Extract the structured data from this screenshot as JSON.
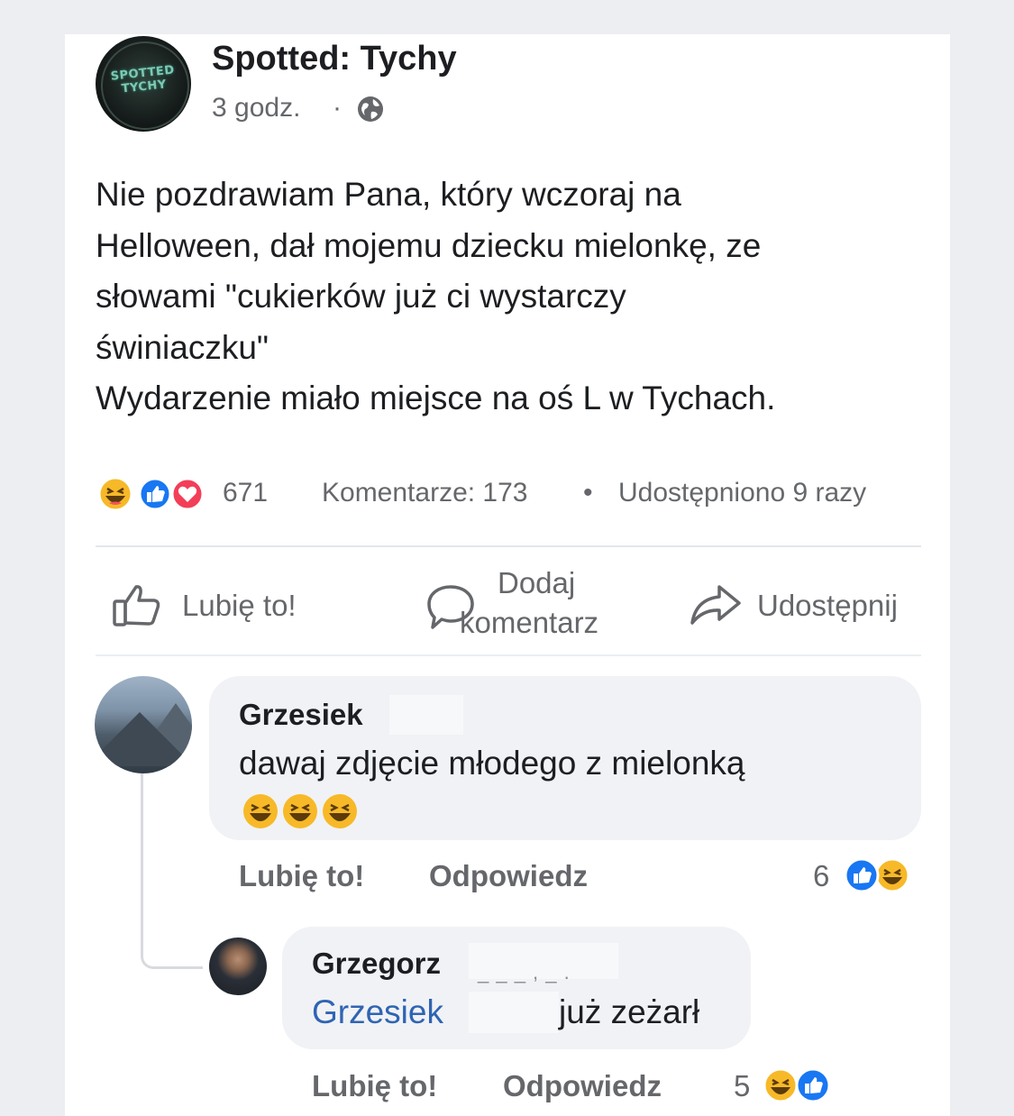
{
  "post": {
    "page_name": "Spotted: Tychy",
    "avatar_text": "SPOTTED TYCHY",
    "time": "3 godz.",
    "time_separator": "·",
    "text_lines": [
      "Nie pozdrawiam Pana, który wczoraj na",
      "Helloween, dał mojemu dziecku mielonkę, ze",
      "słowami \"cukierków już ci wystarczy",
      "świniaczku\"",
      "Wydarzenie miało miejsce na oś L w Tychach."
    ],
    "reactions_count": "671",
    "comments_count": "Komentarze: 173",
    "stats_separator": "•",
    "shares_count": "Udostępniono 9 razy",
    "reaction_icons": [
      "haha-icon",
      "like-icon",
      "love-icon"
    ]
  },
  "actions": {
    "like": "Lubię to!",
    "comment_line1": "Dodaj",
    "comment_line2": "komentarz",
    "share": "Udostępnij"
  },
  "comments": [
    {
      "author": "Grzesiek",
      "text": "dawaj zdjęcie młodego z mielonką",
      "emoji": [
        "haha-icon",
        "haha-icon",
        "haha-icon"
      ],
      "like_label": "Lubię to!",
      "reply_label": "Odpowiedz",
      "reactions_count": "6",
      "reaction_icons": [
        "like-icon",
        "haha-icon"
      ]
    },
    {
      "author": "Grzegorz",
      "mention": "Grzesiek",
      "text": "już zeżarł",
      "like_label": "Lubię to!",
      "reply_label": "Odpowiedz",
      "reactions_count": "5",
      "reaction_icons": [
        "haha-icon",
        "like-icon"
      ]
    }
  ],
  "colors": {
    "like_blue": "#1877f2",
    "love_red": "#f33e58",
    "haha_yellow": "#f7b928",
    "mention_blue": "#2f64b3",
    "muted_text": "#65676b",
    "bubble_bg": "#f0f2f5"
  }
}
